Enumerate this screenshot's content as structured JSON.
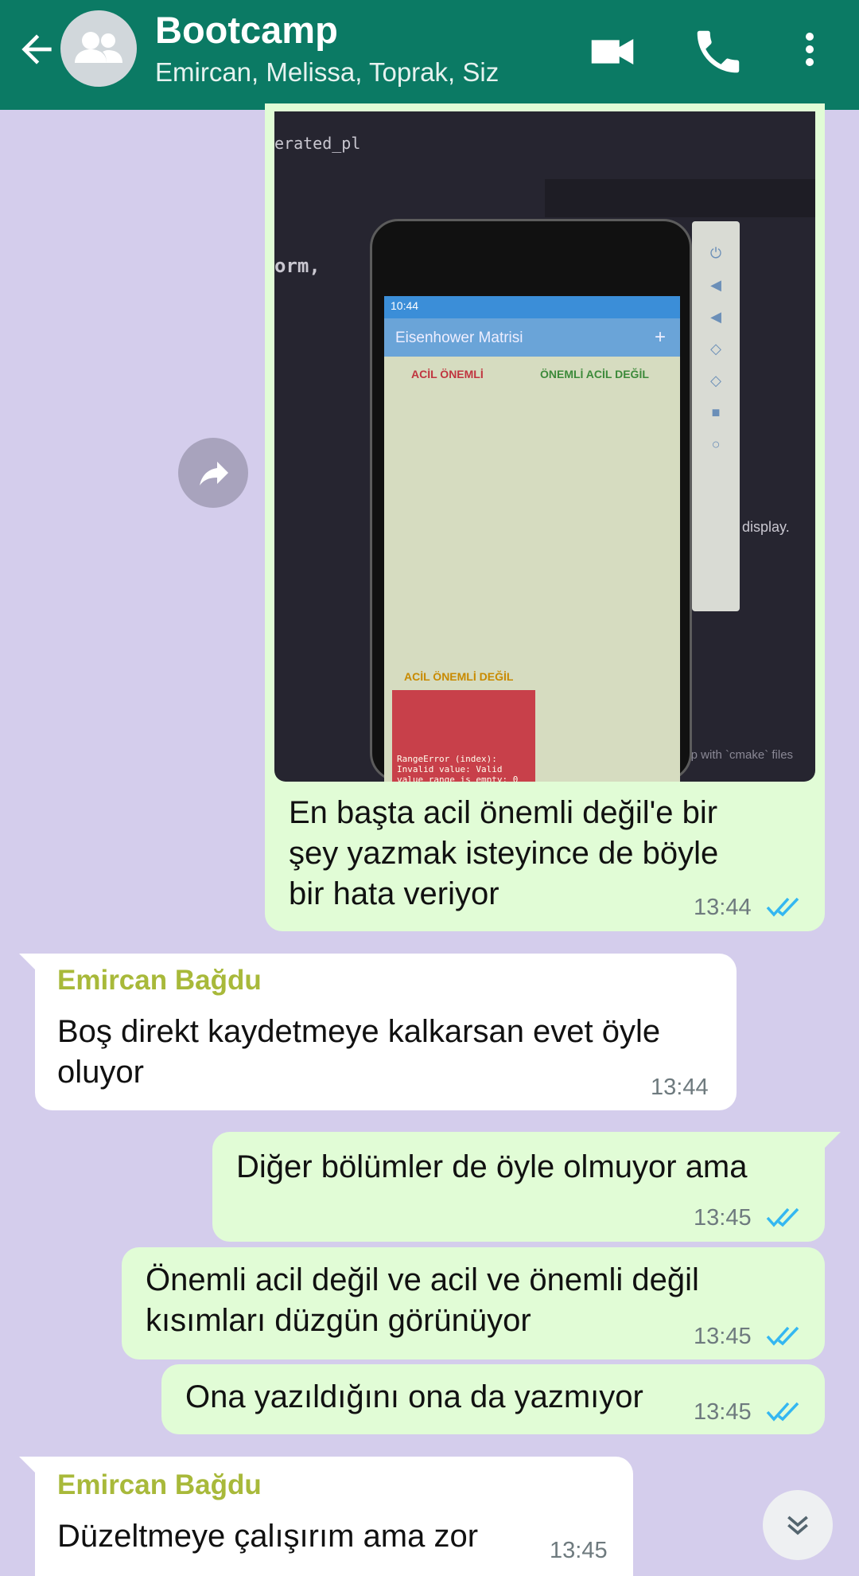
{
  "header": {
    "title": "Bootcamp",
    "subtitle": "Emircan, Melissa, Toprak, Siz"
  },
  "image_message": {
    "screen_text": {
      "tab_label": "erated_pl",
      "code_fragment": "orm,",
      "phone_time": "10:44",
      "app_title": "Eisenhower Matrisi",
      "app_plus": "+",
      "q_acil_onemli": "ACİL ÖNEMLİ",
      "q_onemli_acil_degil": "ÖNEMLİ ACİL DEĞİL",
      "q_acil_onemli_degil": "ACİL ÖNEMLİ DEĞİL",
      "error_text": "RangeError (index):\nInvalid value: Valid\nvalue range is empty: 0\nSee also: https://\nflutter.dev/docs/\ntesting/errors",
      "display_text": "display.",
      "cmake_text": "elp with `cmake` files"
    }
  },
  "messages": [
    {
      "id": "m1",
      "direction": "out",
      "lines": [
        "En başta acil önemli değil'e bir",
        "şey yazmak isteyince de böyle",
        "bir hata veriyor"
      ],
      "time": "13:44",
      "status": "read"
    },
    {
      "id": "m2",
      "direction": "in",
      "sender": "Emircan Bağdu",
      "lines": [
        "Boş direkt kaydetmeye kalkarsan evet öyle",
        "oluyor"
      ],
      "time": "13:44"
    },
    {
      "id": "m3",
      "direction": "out",
      "lines": [
        "Diğer bölümler de öyle olmuyor ama"
      ],
      "time": "13:45",
      "status": "read"
    },
    {
      "id": "m4",
      "direction": "out",
      "lines": [
        "Önemli acil değil ve acil ve önemli değil",
        "kısımları düzgün görünüyor"
      ],
      "time": "13:45",
      "status": "read"
    },
    {
      "id": "m5",
      "direction": "out",
      "lines": [
        "Ona yazıldığını ona da yazmıyor"
      ],
      "time": "13:45",
      "status": "read"
    },
    {
      "id": "m6",
      "direction": "in",
      "sender": "Emircan Bağdu",
      "lines": [
        "Düzeltmeye çalışırım ama zor"
      ],
      "time": "13:45"
    }
  ],
  "colors": {
    "header": "#0b7a64",
    "chat_background": "#d4cdec",
    "outgoing_bubble": "#e1fcd6",
    "incoming_bubble": "#ffffff",
    "sender_name": "#a8b93a",
    "read_ticks": "#34b7f1"
  },
  "icons": [
    "back-arrow-icon",
    "group-avatar-icon",
    "video-call-icon",
    "phone-icon",
    "more-vert-icon",
    "forward-icon",
    "double-check-icon",
    "scroll-down-icon"
  ]
}
